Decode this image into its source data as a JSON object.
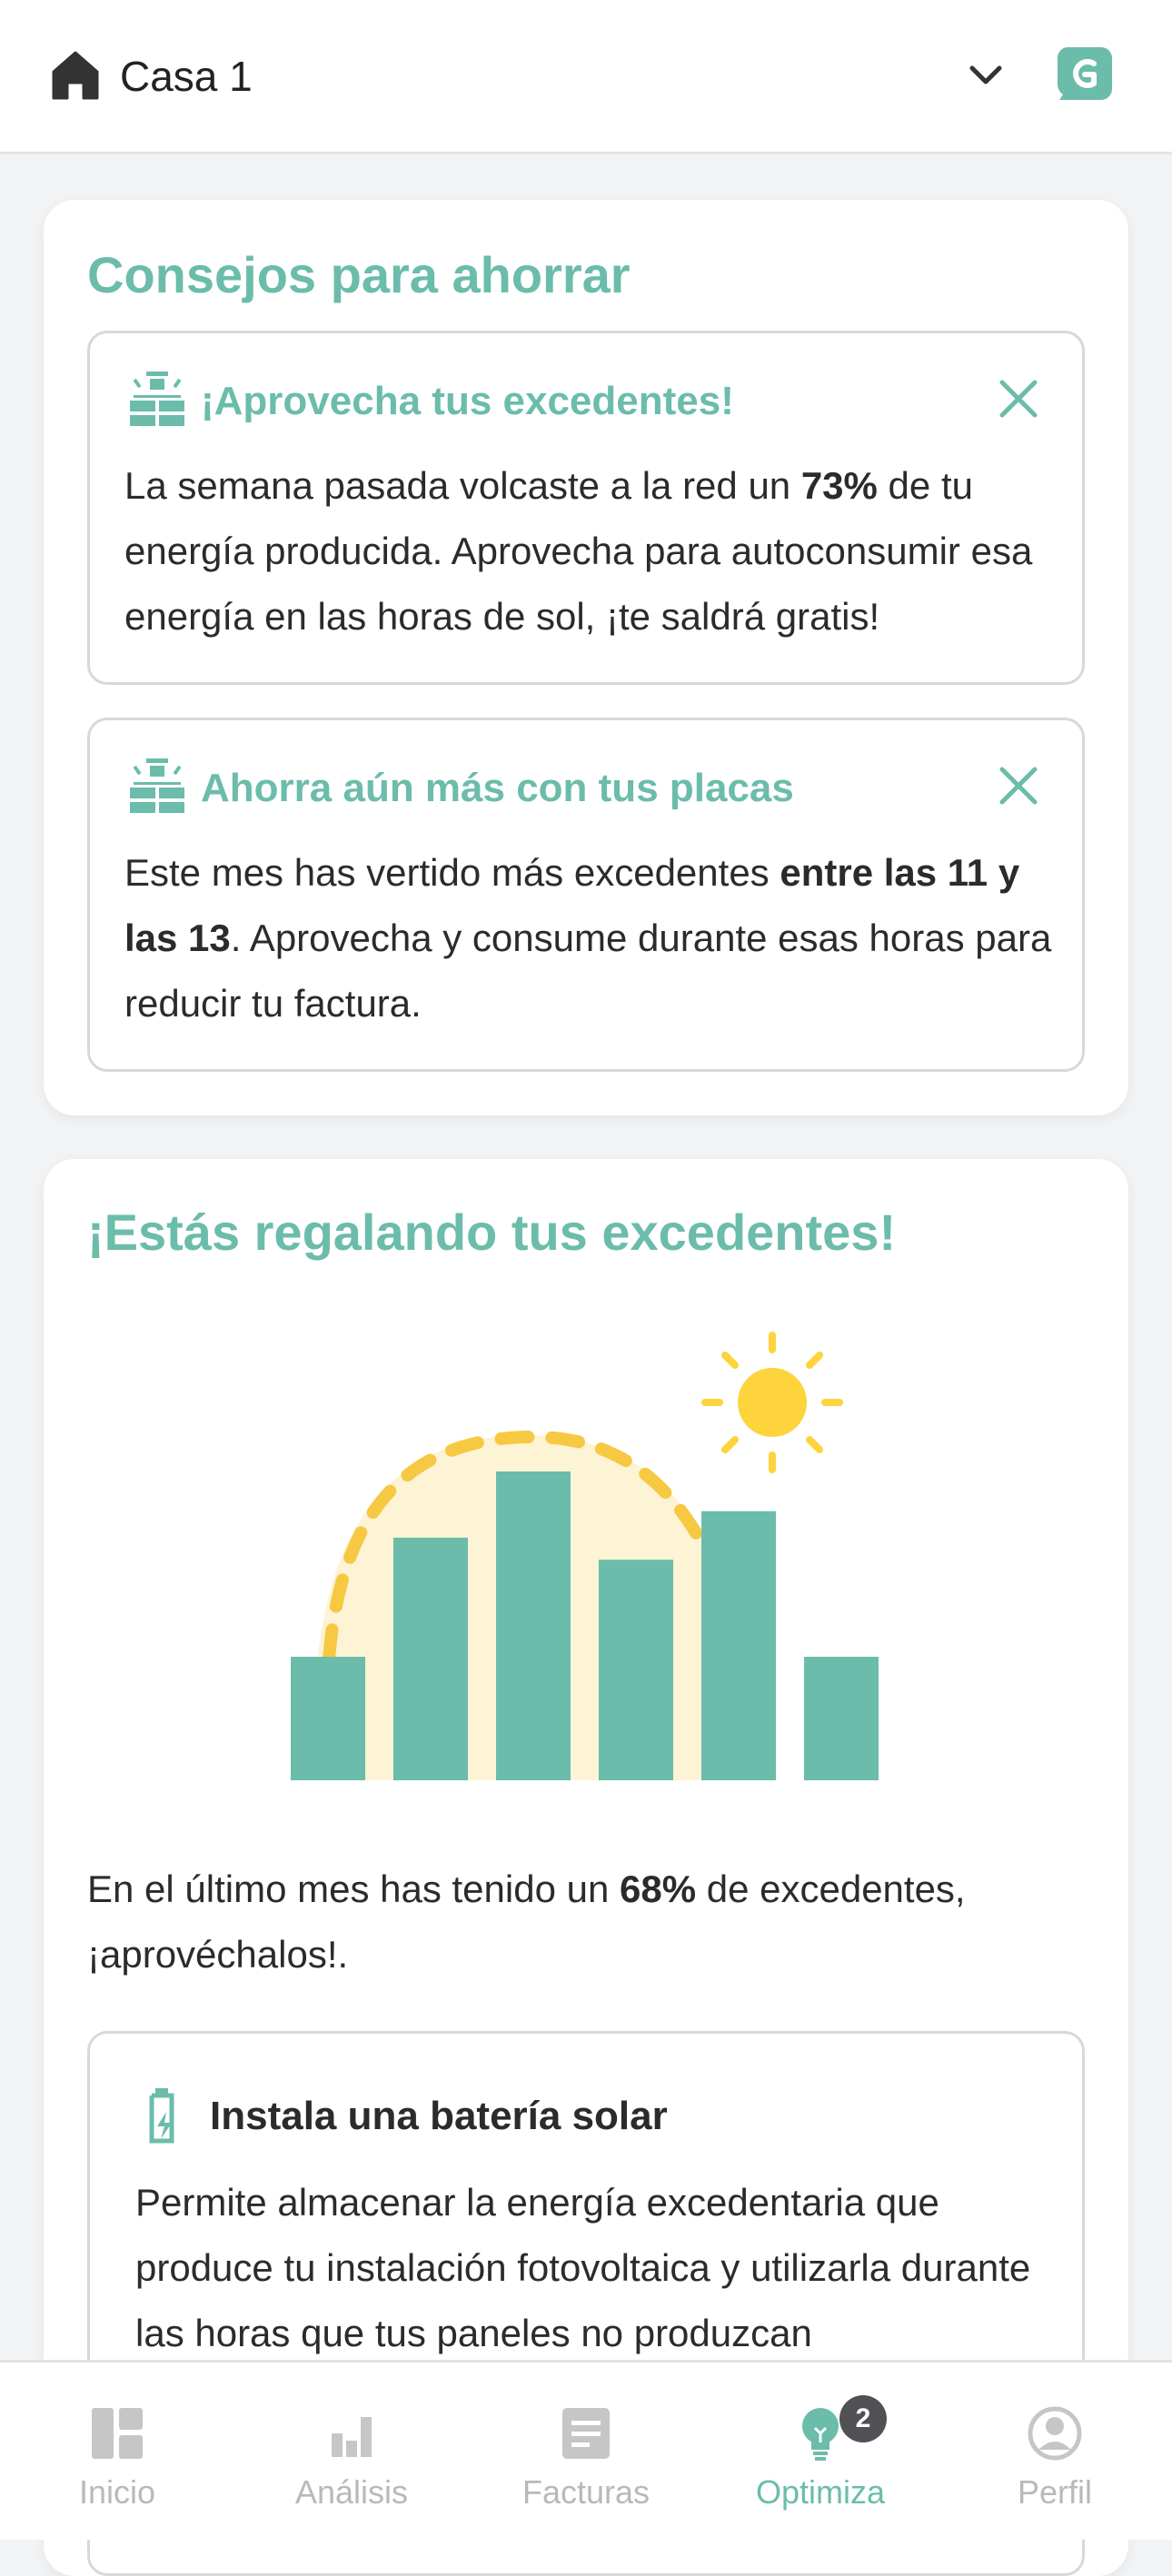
{
  "header": {
    "house_name": "Casa 1",
    "icons": [
      "home-icon",
      "chevron-down-icon",
      "brand-logo-icon"
    ]
  },
  "tips_card": {
    "title": "Consejos para ahorrar",
    "tips": [
      {
        "icon": "solar-panel-icon",
        "title": "¡Aprovecha tus excedentes!",
        "body_before": "La semana pasada volcaste a la red un ",
        "body_bold": "73%",
        "body_after": " de tu energía producida. Aprovecha para autoconsumir esa energía en las horas de sol, ¡te saldrá gratis!"
      },
      {
        "icon": "solar-panel-icon",
        "title": "Ahorra aún más con tus placas",
        "body_before": "Este mes has vertido más excedentes ",
        "body_bold": "entre las 11 y las 13",
        "body_after": ". Aprovecha y consume durante esas horas para reducir tu factura."
      }
    ]
  },
  "surplus_card": {
    "title": "¡Estás regalando tus excedentes!",
    "illustration": {
      "bars": [
        0.28,
        0.55,
        0.7,
        0.5,
        0.61,
        0.28
      ],
      "colors": {
        "bar": "#6bbcab",
        "sun": "#fdd43c",
        "glow": "#fdf3d5",
        "arc": "#f7c842"
      }
    },
    "text_before": "En el último mes has tenido un ",
    "text_bold": "68%",
    "text_after": " de excedentes, ¡aprovéchalos!.",
    "battery": {
      "icon": "battery-charging-icon",
      "title": "Instala una batería solar",
      "body": "Permite almacenar la energía excedentaria que produce tu instalación fotovoltaica y utilizarla durante las horas que tus paneles no produzcan"
    }
  },
  "tabbar": {
    "tabs": [
      {
        "label": "Inicio",
        "icon": "dashboard-icon"
      },
      {
        "label": "Análisis",
        "icon": "bar-chart-icon"
      },
      {
        "label": "Facturas",
        "icon": "invoice-icon"
      },
      {
        "label": "Optimiza",
        "icon": "lightbulb-icon",
        "badge": "2",
        "active": true
      },
      {
        "label": "Perfil",
        "icon": "user-icon"
      }
    ]
  },
  "colors": {
    "accent": "#6bbcab",
    "text": "#2b2b2b",
    "inactive": "#b9b9b9",
    "background": "#f2f3f5"
  }
}
